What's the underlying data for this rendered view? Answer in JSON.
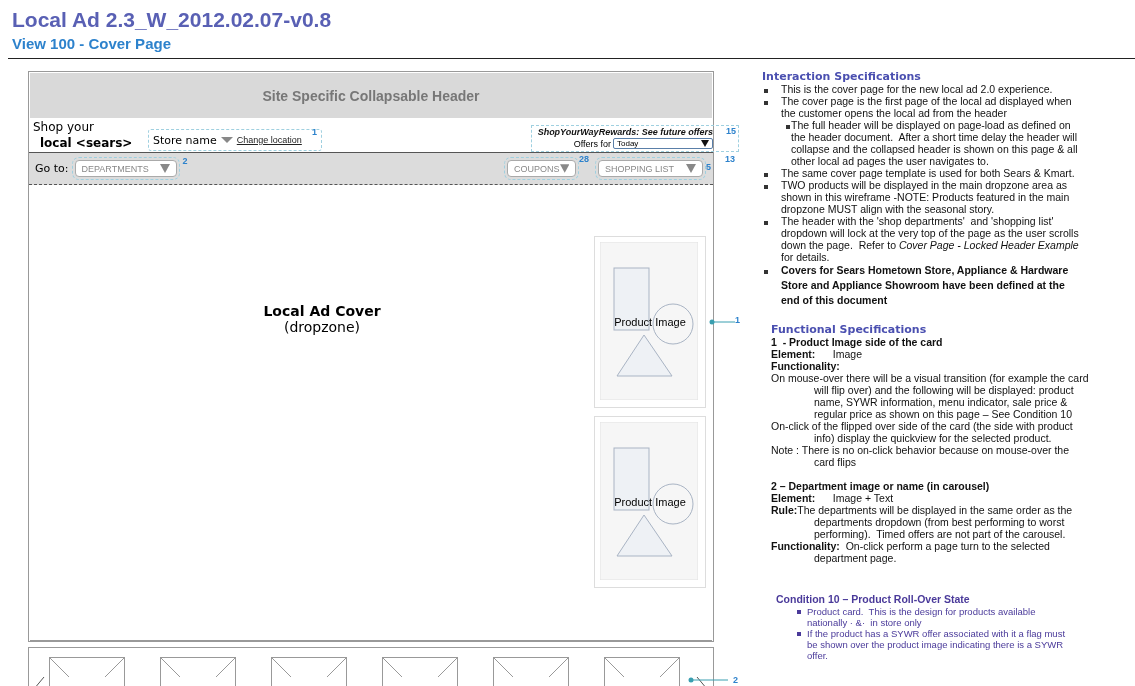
{
  "doc_title": "Local Ad 2.3_W_2012.02.07-v0.8",
  "view_title": "View 100 - Cover Page",
  "wireframe": {
    "header_title": "Site Specific Collapsable Header",
    "shop_your": "Shop your",
    "local_brand": "local <sears>",
    "store": {
      "name": "Store name",
      "change_location": "Change location",
      "callout": "1"
    },
    "rewards": {
      "link": "ShopYourWayRewards: See future offers",
      "offers_for": "Offers for",
      "offers_value": "Today",
      "callout": "15"
    },
    "nav_callout": "13",
    "goto_label": "Go to:",
    "departments": {
      "label": "DEPARTMENTS",
      "callout": "2"
    },
    "coupons": {
      "label": "COUPONS",
      "callout": "28"
    },
    "shopping_list": {
      "label": "SHOPPING LIST",
      "callout": "5"
    },
    "cover_title": "Local Ad Cover",
    "cover_subtitle": "(dropzone)",
    "products": [
      {
        "label": "Product Image",
        "callout": "1"
      },
      {
        "label": "Product Image"
      }
    ],
    "carousel_callout": "2"
  },
  "interaction": {
    "title": "Interaction Specifications",
    "items": [
      {
        "kind": "bullet",
        "text": "This is the cover page for the new local ad 2.0 experience."
      },
      {
        "kind": "bullet",
        "text": "The cover page is the first page of the local ad displayed when the customer opens the local ad from the header"
      },
      {
        "kind": "sub",
        "text": "The full header will be displayed on page-load as defined on the header document.  After a short time delay the header will collapse and the collapsed header is shown on this page & all other local ad pages the user navigates to."
      },
      {
        "kind": "bullet",
        "text": "The same cover page template is used for both Sears & Kmart."
      },
      {
        "kind": "bullet",
        "text": "TWO products will be displayed in the main dropzone area as shown in this wireframe -NOTE: Products featured in the main dropzone MUST align with the seasonal story."
      },
      {
        "kind": "bullet",
        "text": "The header with the 'shop departments'  and 'shopping list' dropdown will lock at the very top of the page as the user scrolls down the page.  Refer to *Cover Page - Locked Header Example* for details."
      },
      {
        "kind": "bold",
        "text": "Covers for Sears Hometown Store, Appliance & Hardware Store and Appliance Showroom have been defined at the end of this document"
      }
    ]
  },
  "functional": {
    "title": "Functional Specifications",
    "items": [
      {
        "kind": "heading",
        "text": "**1  - Product Image side of the card**"
      },
      {
        "kind": "field",
        "text": "**Element:**      Image"
      },
      {
        "kind": "heading",
        "text": "**Functionality:**"
      },
      {
        "kind": "hanging",
        "text": "On mouse-over there will be a visual transition (for example the card will flip over) and the following will be displayed: product name, SYWR information, menu indicator, sale price & regular price as shown on this page – See Condition 10"
      },
      {
        "kind": "hanging",
        "text": "On-click of the flipped over side of the card (the side with product info) display the quickview for the selected product."
      },
      {
        "kind": "hanging",
        "text": "Note : There is no on-click behavior because on mouse-over the card flips"
      },
      {
        "kind": "heading",
        "text": "**2 – Department image or name (in carousel)**"
      },
      {
        "kind": "field",
        "text": "**Element:**      Image + Text"
      },
      {
        "kind": "hanging",
        "text": "**Rule:**The departments will be displayed in the same order as the departments dropdown (from best performing to worst performing).  Timed offers are not part of the carousel."
      },
      {
        "kind": "hanging",
        "text": "**Functionality:**  On-click perform a page turn to the selected department page."
      }
    ]
  },
  "condition": {
    "title": "Condition 10 – Product Roll-Over State",
    "items": [
      "Product card.  This is the design for products available nationally · &·  in store only",
      "If the product has a SYWR offer associated with it a flag must be shown over the product image indicating there is a SYWR offer."
    ]
  }
}
